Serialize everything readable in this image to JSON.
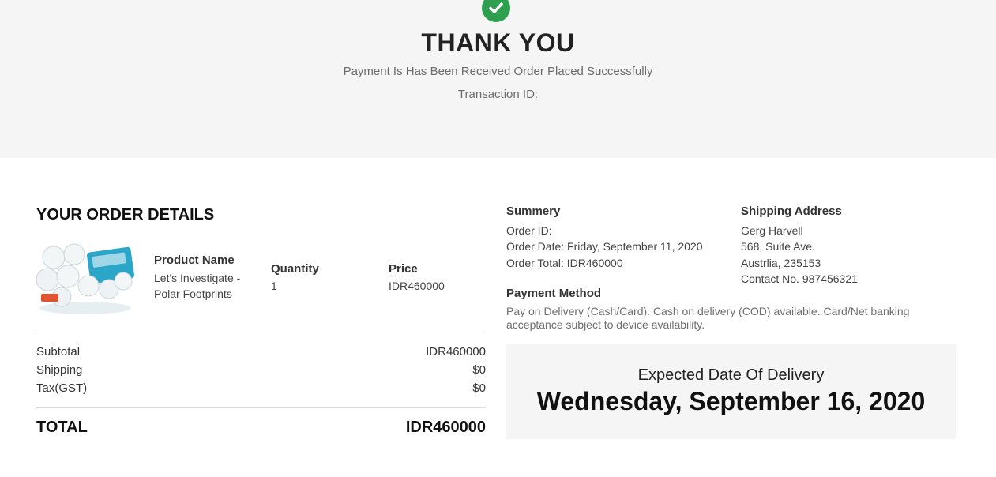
{
  "hero": {
    "title": "THANK YOU",
    "subtitle": "Payment Is Has Been Received Order Placed Successfully",
    "transaction_label": "Transaction ID:",
    "success_color": "#2e9e4f",
    "icon": "check-circle-icon"
  },
  "order": {
    "title": "YOUR ORDER DETAILS",
    "columns": {
      "product": "Product Name",
      "quantity": "Quantity",
      "price": "Price"
    },
    "item": {
      "name_line1": "Let's Investigate -",
      "name_line2": "Polar Footprints",
      "quantity": "1",
      "price": "IDR460000"
    },
    "subtotal_label": "Subtotal",
    "subtotal_value": "IDR460000",
    "shipping_label": "Shipping",
    "shipping_value": "$0",
    "tax_label": "Tax(GST)",
    "tax_value": "$0",
    "total_label": "TOTAL",
    "total_value": "IDR460000"
  },
  "summary": {
    "title": "Summery",
    "order_id": "Order ID:",
    "order_date": "Order Date: Friday, September 11, 2020",
    "order_total": "Order Total: IDR460000"
  },
  "shipping_address": {
    "title": "Shipping Address",
    "name": "Gerg Harvell",
    "street": "568, Suite Ave.",
    "city": "Austrlia, 235153",
    "contact": "Contact No. 987456321"
  },
  "payment": {
    "title": "Payment Method",
    "text": "Pay on Delivery (Cash/Card). Cash on delivery (COD) available. Card/Net banking acceptance subject to device availability."
  },
  "delivery": {
    "label": "Expected Date Of Delivery",
    "date": "Wednesday, September 16, 2020"
  }
}
